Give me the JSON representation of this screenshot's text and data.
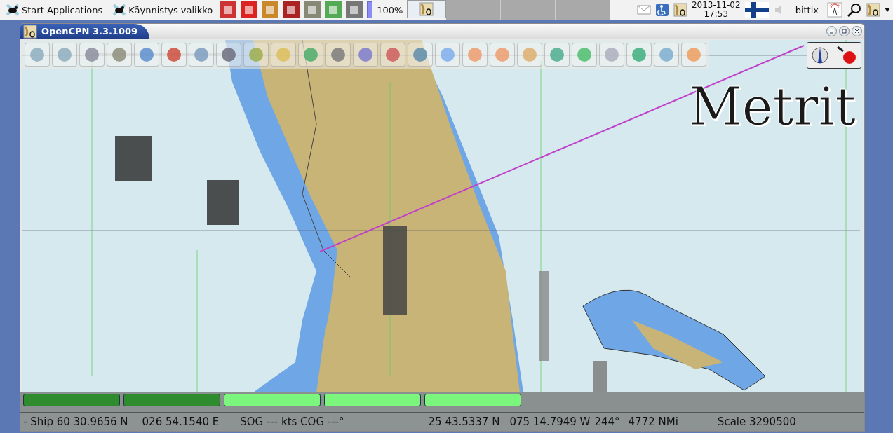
{
  "panel": {
    "menus": [
      {
        "label": "Start Applications"
      },
      {
        "label": "Käynnistys valikko"
      }
    ],
    "zoom": "100%",
    "tasks": [
      {
        "selected": true
      },
      {
        "selected": false
      },
      {
        "selected": false
      },
      {
        "selected": false
      }
    ],
    "date": "2013-11-02",
    "time": "17:53",
    "user": "bittix"
  },
  "window": {
    "title": "OpenCPN 3.3.1009"
  },
  "chart": {
    "overlay_text": "Metrit"
  },
  "status_segments": [
    {
      "color": "#2e8b2e"
    },
    {
      "color": "#2e8b2e"
    },
    {
      "color": "#7cf57c"
    },
    {
      "color": "#7cf57c"
    },
    {
      "color": "#7cf57c"
    }
  ],
  "status_bar": {
    "ship": "- Ship 60 30.9656 N",
    "ship_lon": "026 54.1540 E",
    "sog": "SOG --- kts COG ---°",
    "cursor_lat": "25 43.5337 N",
    "cursor_lon": "075 14.7949 W",
    "bearing": "244°",
    "distance": "4772 NMi",
    "scale": "Scale 3290500"
  }
}
